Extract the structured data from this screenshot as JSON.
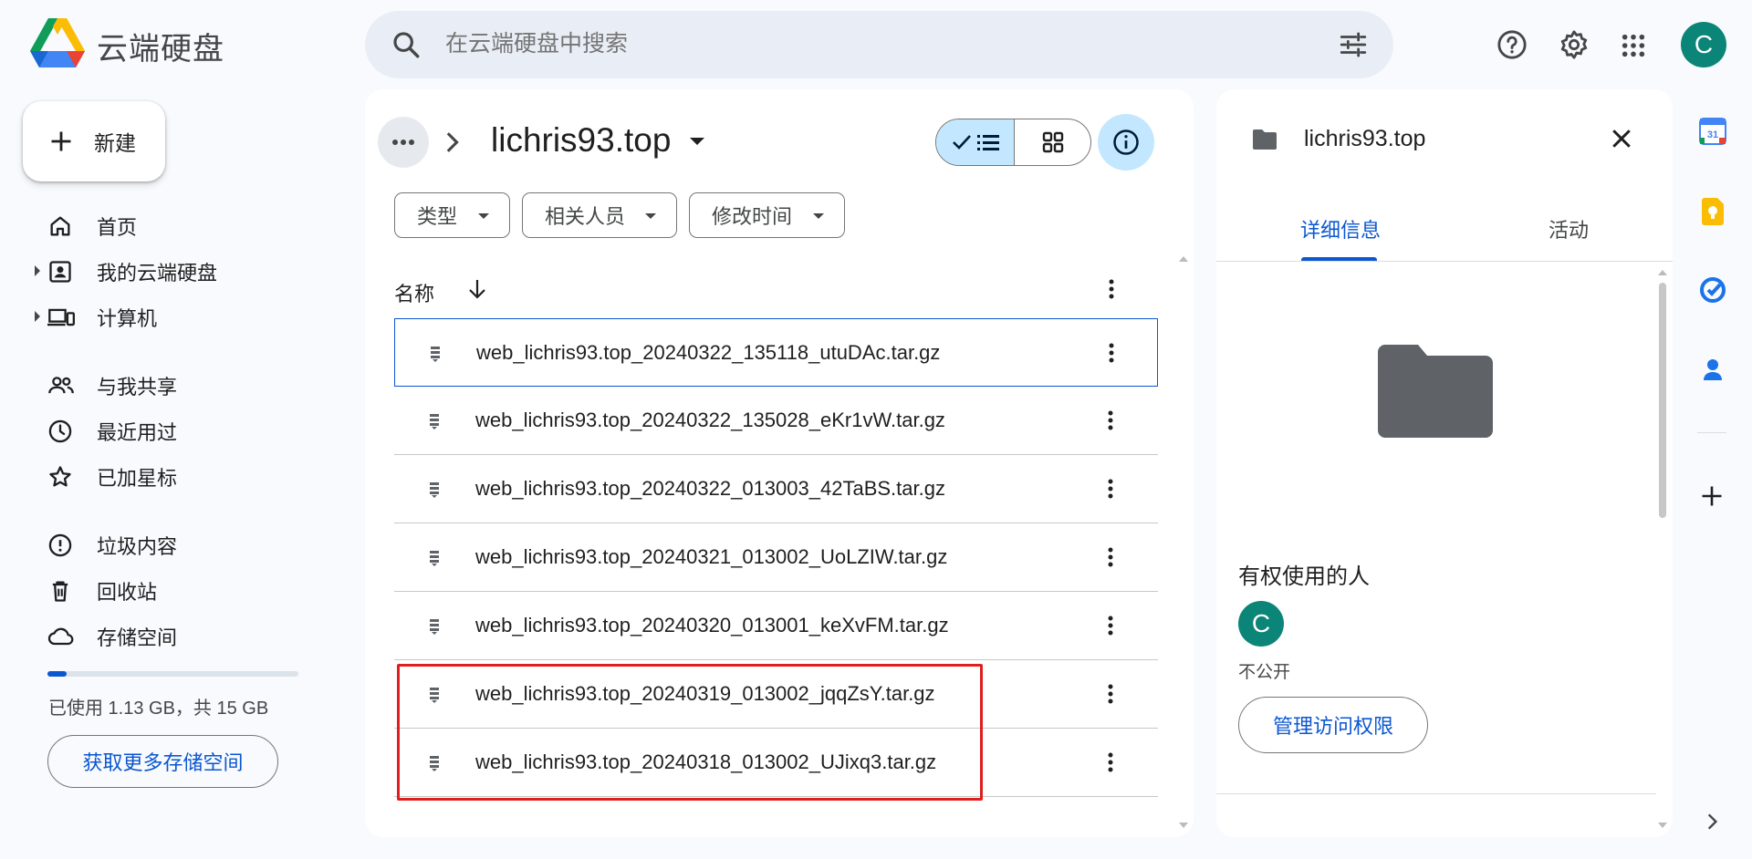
{
  "app": {
    "title": "云端硬盘"
  },
  "search": {
    "placeholder": "在云端硬盘中搜索"
  },
  "header": {
    "icons": [
      "search-icon",
      "tune-icon",
      "help-icon",
      "gear-icon",
      "apps-grid-icon"
    ],
    "avatar_letter": "C"
  },
  "sidebar": {
    "new_label": "新建",
    "items": [
      {
        "label": "首页",
        "icon": "home-icon"
      },
      {
        "label": "我的云端硬盘",
        "icon": "my-drive-icon"
      },
      {
        "label": "计算机",
        "icon": "computers-icon"
      },
      {
        "label": "与我共享",
        "icon": "shared-people-icon"
      },
      {
        "label": "最近用过",
        "icon": "clock-icon"
      },
      {
        "label": "已加星标",
        "icon": "star-icon"
      },
      {
        "label": "垃圾内容",
        "icon": "spam-icon"
      },
      {
        "label": "回收站",
        "icon": "trash-icon"
      },
      {
        "label": "存储空间",
        "icon": "cloud-icon"
      }
    ],
    "storage": {
      "text": "已使用 1.13 GB，共 15 GB",
      "used_fraction": 0.075,
      "button_label": "获取更多存储空间"
    }
  },
  "main": {
    "folder_title": "lichris93.top",
    "filters": [
      "类型",
      "相关人员",
      "修改时间"
    ],
    "column_name": "名称",
    "files": [
      "web_lichris93.top_20240322_135118_utuDAc.tar.gz",
      "web_lichris93.top_20240322_135028_eKr1vW.tar.gz",
      "web_lichris93.top_20240322_013003_42TaBS.tar.gz",
      "web_lichris93.top_20240321_013002_UoLZIW.tar.gz",
      "web_lichris93.top_20240320_013001_keXvFM.tar.gz",
      "web_lichris93.top_20240319_013002_jqqZsY.tar.gz",
      "web_lichris93.top_20240318_013002_UJixq3.tar.gz"
    ]
  },
  "details": {
    "title": "lichris93.top",
    "tabs": [
      "详细信息",
      "活动"
    ],
    "access_heading": "有权使用的人",
    "access_avatar_letter": "C",
    "access_status": "不公开",
    "manage_access_label": "管理访问权限"
  },
  "right_rail": {
    "icons": [
      "calendar-icon",
      "keep-icon",
      "tasks-icon",
      "contacts-icon"
    ],
    "calendar_day": "31"
  },
  "colors": {
    "accent": "#0b57d0",
    "selected_bg": "#c2e7ff",
    "avatar": "#0b8577",
    "highlight": "#e01e1e",
    "page_bg": "#f8fafd"
  }
}
